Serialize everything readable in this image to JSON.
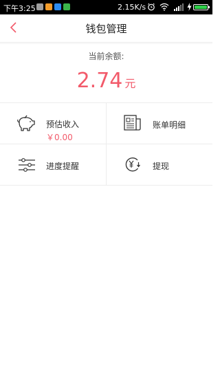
{
  "status_bar": {
    "time": "下午3:25",
    "network_speed": "2.15K/s",
    "notification_icons": [
      "calendar-app-icon",
      "browser-app-icon",
      "map-app-icon",
      "wechat-app-icon"
    ],
    "battery_color": "#2fd04a"
  },
  "header": {
    "title": "钱包管理",
    "back_icon": "chevron-left-icon"
  },
  "balance": {
    "label": "当前余额:",
    "amount": "2.74",
    "unit": "元",
    "color": "#f25a6a"
  },
  "menu": {
    "items": [
      {
        "label": "预估收入",
        "value": "￥0.00",
        "icon": "piggy-bank-icon"
      },
      {
        "label": "账单明细",
        "icon": "bill-newspaper-icon"
      },
      {
        "label": "进度提醒",
        "icon": "sliders-icon"
      },
      {
        "label": "提现",
        "icon": "withdraw-yen-icon"
      }
    ]
  }
}
